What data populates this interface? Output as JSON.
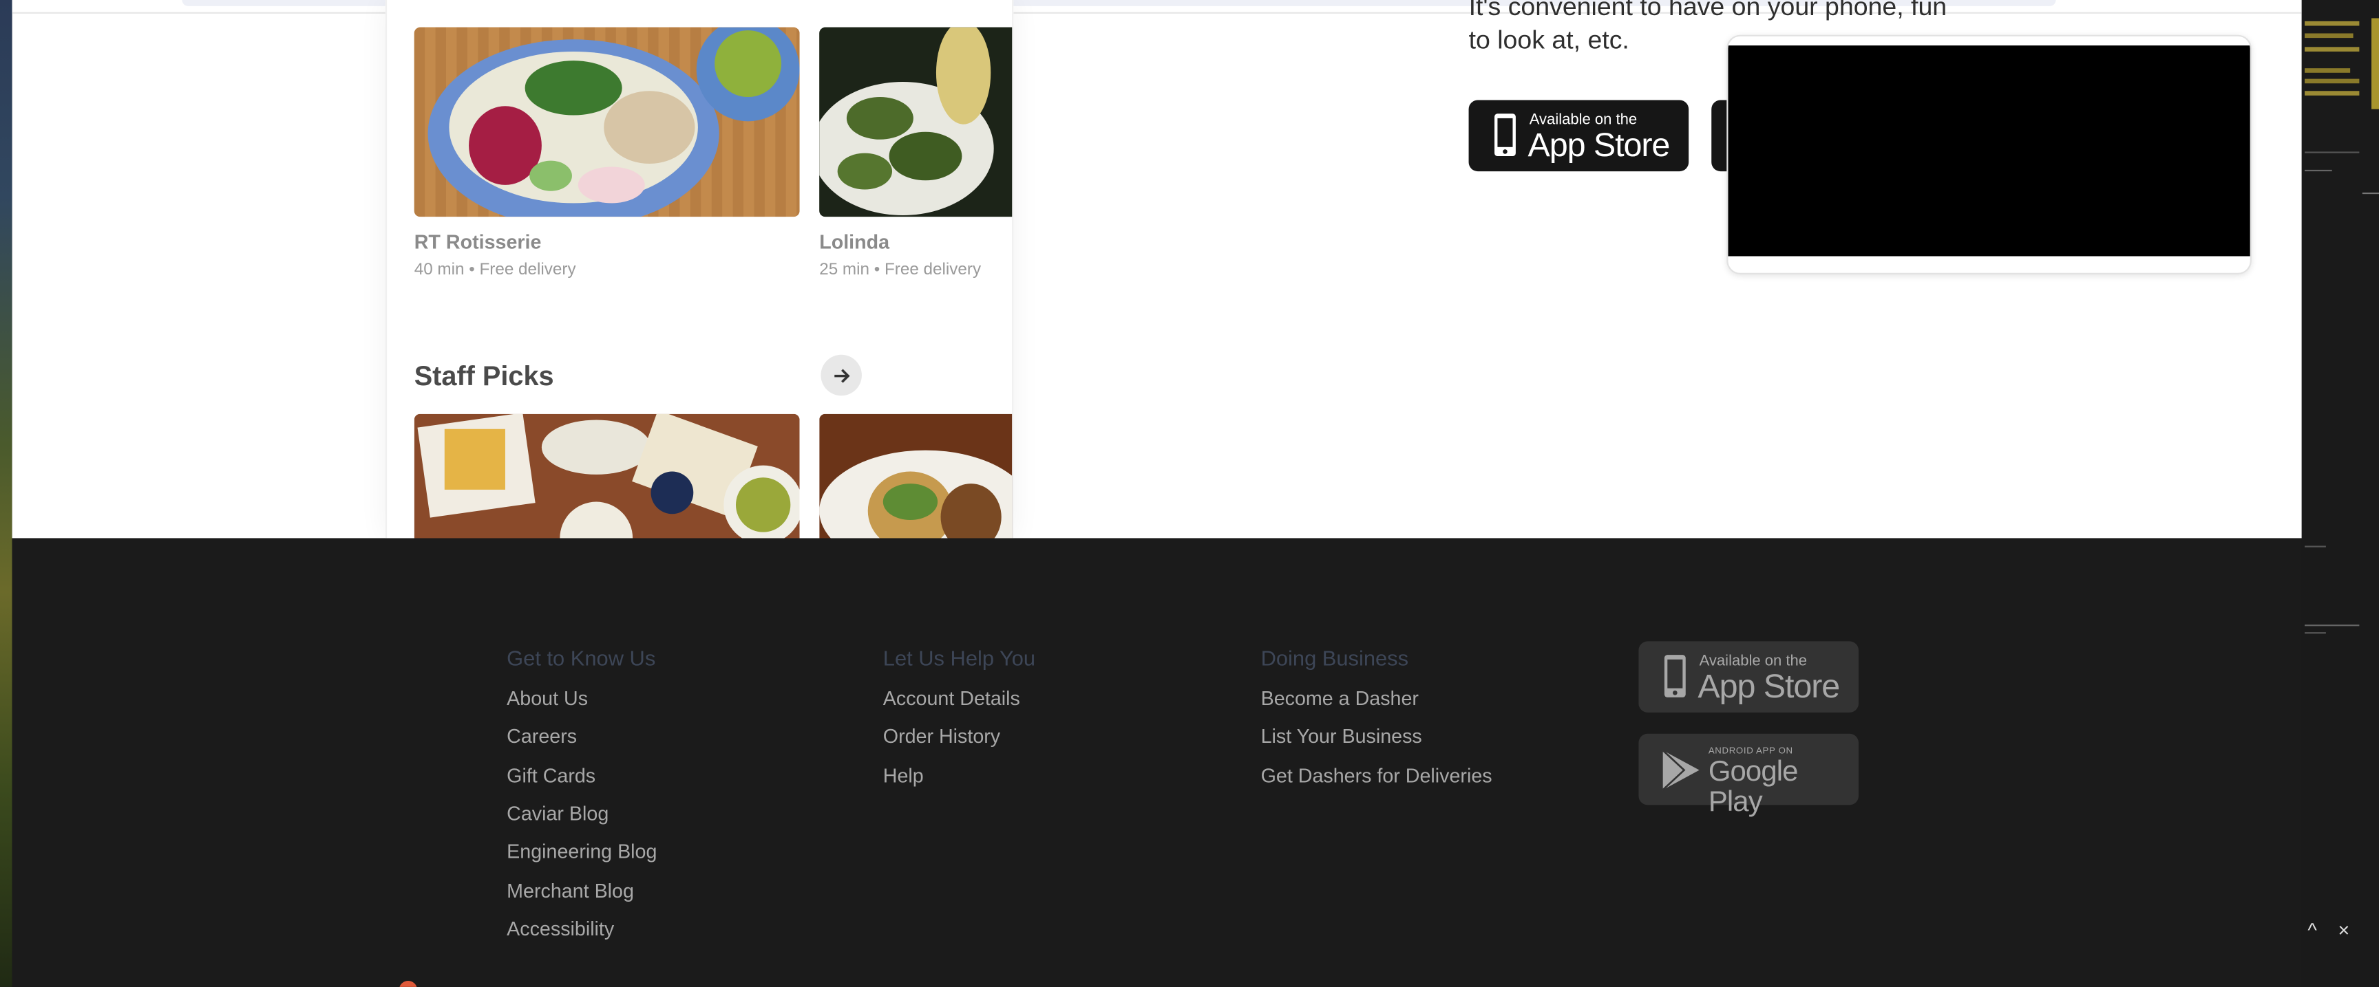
{
  "blurb": "It's convenient to have on your phone, fun to look at, etc.",
  "hero_badges": {
    "app_store_small": "Available on the",
    "app_store_big": "App Store"
  },
  "restaurants": [
    {
      "name": "RT Rotisserie",
      "meta": "40 min • Free delivery"
    },
    {
      "name": "Lolinda",
      "meta": "25 min • Free delivery"
    }
  ],
  "staff_picks": {
    "title": "Staff Picks"
  },
  "footer": {
    "columns": [
      {
        "heading": "Get to Know Us",
        "links": [
          "About Us",
          "Careers",
          "Gift Cards",
          "Caviar Blog",
          "Engineering Blog",
          "Merchant Blog",
          "Accessibility"
        ]
      },
      {
        "heading": "Let Us Help You",
        "links": [
          "Account Details",
          "Order History",
          "Help"
        ]
      },
      {
        "heading": "Doing Business",
        "links": [
          "Become a Dasher",
          "List Your Business",
          "Get Dashers for Deliveries"
        ]
      }
    ],
    "app_store": {
      "small": "Available on the",
      "big": "App Store"
    },
    "google_play": {
      "small": "ANDROID APP ON",
      "big": "Google Play"
    }
  },
  "window_controls": {
    "collapse": "^",
    "close": "×"
  },
  "colors": {
    "footer_bg": "#1b1b1b",
    "footer_heading": "#3d4657",
    "footer_link": "#a8a8a8",
    "badge_dark": "#161616"
  }
}
